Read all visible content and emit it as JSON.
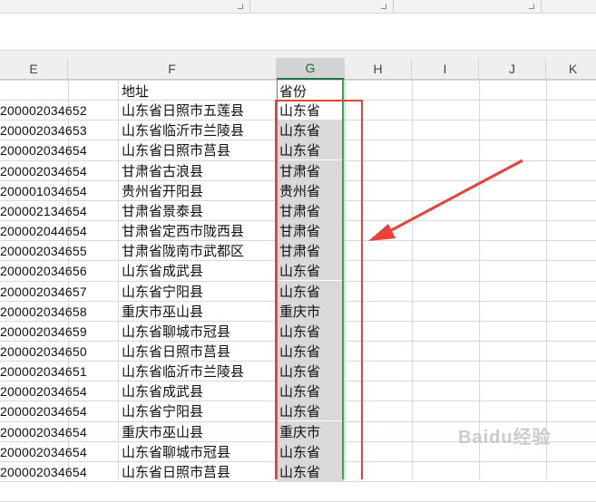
{
  "columns": [
    "E",
    "F",
    "G",
    "H",
    "I",
    "J",
    "K"
  ],
  "selected_column": "G",
  "header_row": {
    "f": "地址",
    "g": "省份"
  },
  "rows": [
    {
      "e": "200002034652",
      "f": "山东省日照市五莲县",
      "g": "山东省"
    },
    {
      "e": "200002034653",
      "f": "山东省临沂市兰陵县",
      "g": "山东省"
    },
    {
      "e": "200002034654",
      "f": "山东省日照市莒县",
      "g": "山东省"
    },
    {
      "e": "200002034654",
      "f": "甘肃省古浪县",
      "g": "甘肃省"
    },
    {
      "e": "200001034654",
      "f": "贵州省开阳县",
      "g": "贵州省"
    },
    {
      "e": "200002134654",
      "f": "甘肃省景泰县",
      "g": "甘肃省"
    },
    {
      "e": "200002044654",
      "f": "甘肃省定西市陇西县",
      "g": "甘肃省"
    },
    {
      "e": "200002034655",
      "f": "甘肃省陇南市武都区",
      "g": "甘肃省"
    },
    {
      "e": "200002034656",
      "f": "山东省成武县",
      "g": "山东省"
    },
    {
      "e": "200002034657",
      "f": "山东省宁阳县",
      "g": "山东省"
    },
    {
      "e": "200002034658",
      "f": "重庆市巫山县",
      "g": "重庆市"
    },
    {
      "e": "200002034659",
      "f": "山东省聊城市冠县",
      "g": "山东省"
    },
    {
      "e": "200002034650",
      "f": "山东省日照市莒县",
      "g": "山东省"
    },
    {
      "e": "200002034651",
      "f": "山东省临沂市兰陵县",
      "g": "山东省"
    },
    {
      "e": "200002034654",
      "f": "山东省成武县",
      "g": "山东省"
    },
    {
      "e": "200002034654",
      "f": "山东省宁阳县",
      "g": "山东省"
    },
    {
      "e": "200002034654",
      "f": "重庆市巫山县",
      "g": "重庆市"
    },
    {
      "e": "200002034654",
      "f": "山东省聊城市冠县",
      "g": "山东省"
    },
    {
      "e": "200002034654",
      "f": "山东省日照市莒县",
      "g": "山东省"
    }
  ],
  "watermark": "Baidu经验",
  "colors": {
    "annotation_red": "#e8413a",
    "selection_green": "#2fa84f",
    "header_selected": "#217346"
  }
}
